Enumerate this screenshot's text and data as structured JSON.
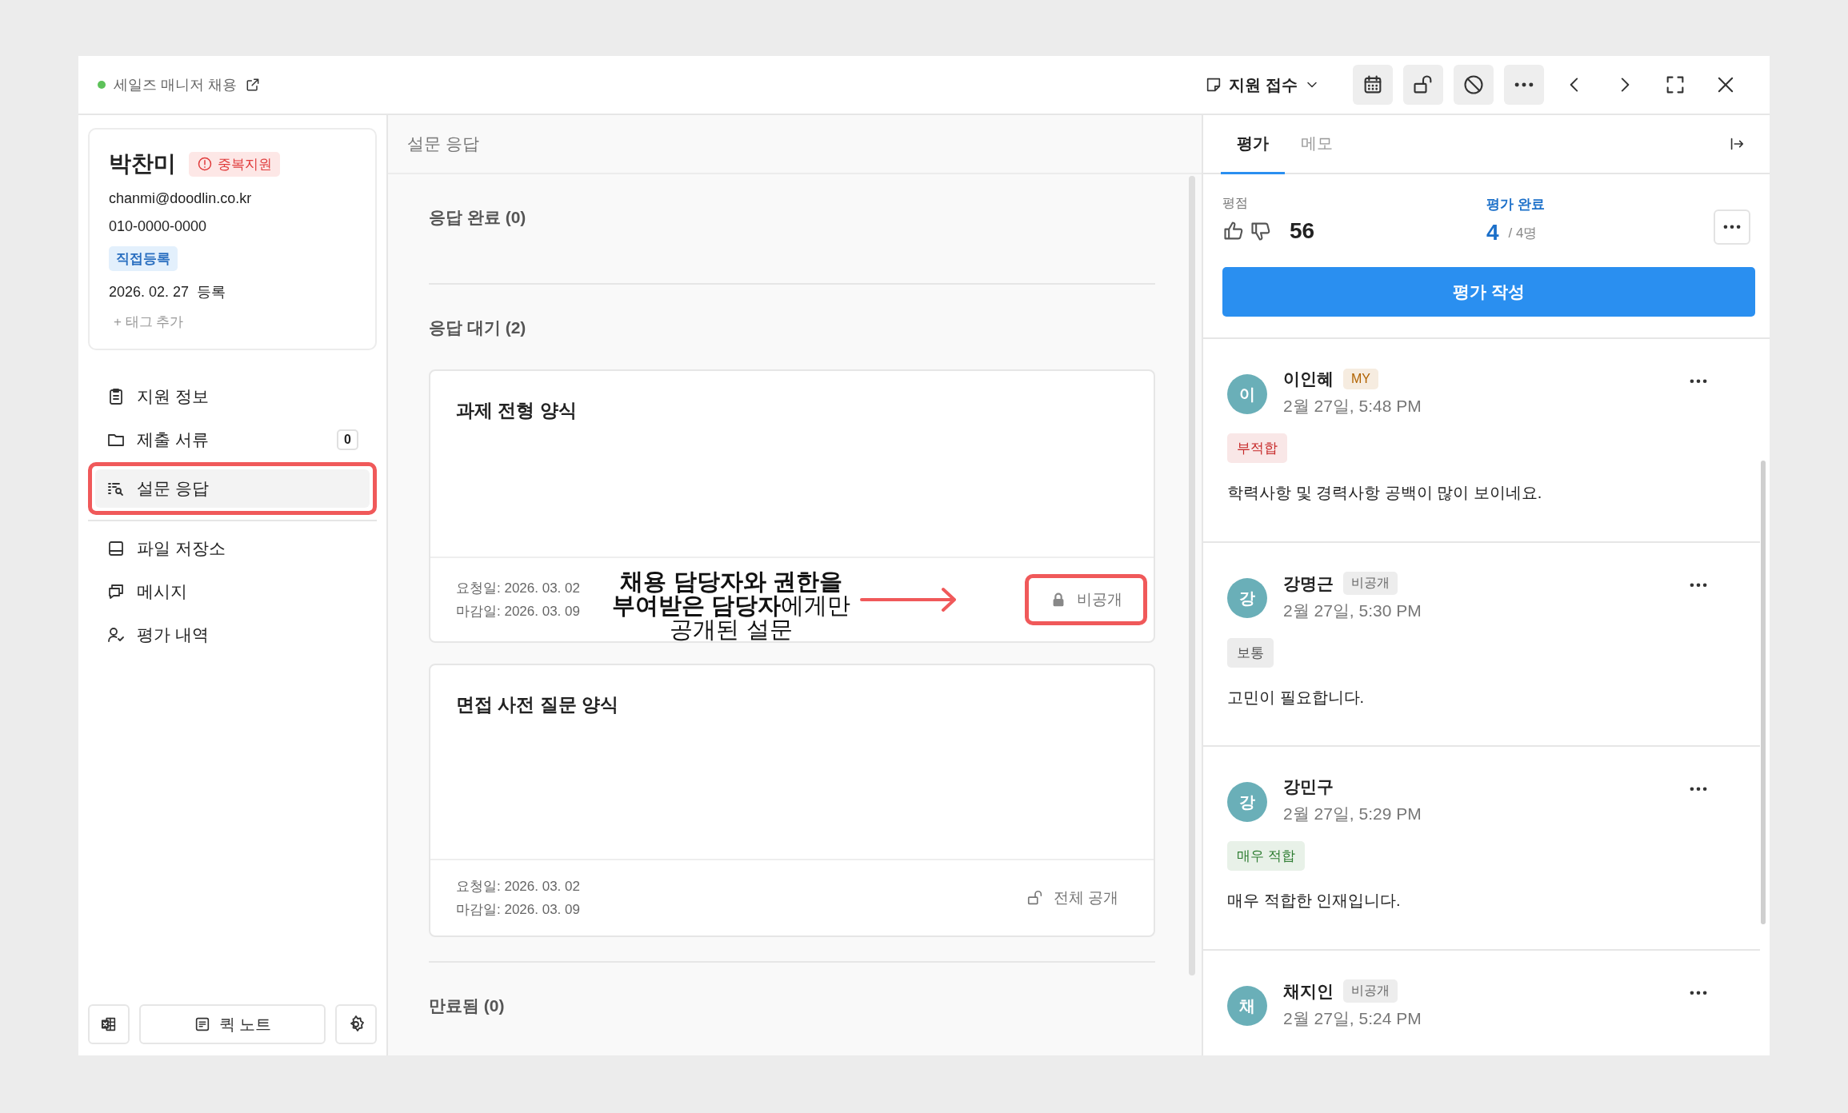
{
  "header": {
    "job_title": "세일즈 매니저 채용",
    "stage": "지원 접수"
  },
  "candidate": {
    "name": "박찬미",
    "badge": "중복지원",
    "email": "chanmi@doodlin.co.kr",
    "phone": "010-0000-0000",
    "source": "직접등록",
    "date": "2026. 02. 27  등록",
    "add_tag": "+ 태그 추가"
  },
  "nav_groups": [
    [
      {
        "label": "지원 정보",
        "selected": false,
        "highlighted": false
      },
      {
        "label": "제출 서류",
        "count": "0",
        "selected": false,
        "highlighted": false
      },
      {
        "label": "설문 응답",
        "selected": true,
        "highlighted": true
      }
    ],
    [
      {
        "label": "파일 저장소",
        "selected": false,
        "highlighted": false
      },
      {
        "label": "메시지",
        "selected": false,
        "highlighted": false
      },
      {
        "label": "평가 내역",
        "selected": false,
        "highlighted": false
      }
    ]
  ],
  "footer": {
    "quick_note": "퀵 노트"
  },
  "survey": {
    "title": "설문 응답",
    "sections": [
      {
        "heading": "응답 완료 (0)"
      },
      {
        "heading": "응답 대기 (2)",
        "cards": [
          {
            "title": "과제 전형 양식",
            "requested": "요청일: 2026. 03. 02",
            "deadline": "마감일: 2026. 03. 09",
            "visibility": "비공개",
            "kind": "private",
            "highlighted": true,
            "annotation": [
              "**채용 담당자와 권한을**",
              "**부여받은 담당자**에게만",
              "공개된 설문"
            ]
          },
          {
            "title": "면접 사전 질문 양식",
            "requested": "요청일: 2026. 03. 02",
            "deadline": "마감일: 2026. 03. 09",
            "visibility": "전체 공개",
            "kind": "public",
            "highlighted": false
          }
        ]
      },
      {
        "heading": "만료됨 (0)"
      }
    ]
  },
  "evaluation": {
    "tabs": [
      {
        "label": "평가",
        "selected": true
      },
      {
        "label": "메모",
        "selected": false
      }
    ],
    "score_label": "평점",
    "score": "56",
    "done_label": "평가 완료",
    "done_count": "4",
    "done_total": "/ 4명",
    "write_button": "평가 작성",
    "entries": [
      {
        "initial": "이",
        "name": "이인혜",
        "badge": {
          "text": "MY",
          "color": "#b06200"
        },
        "time": "2월 27일, 5:48 PM",
        "verdict": {
          "text": "부적합",
          "color": "#c62828"
        },
        "comment": "학력사항 및 경력사항 공백이 많이 보이네요."
      },
      {
        "initial": "강",
        "name": "강명근",
        "badge": {
          "text": "비공개",
          "color": "#666666"
        },
        "time": "2월 27일, 5:30 PM",
        "verdict": {
          "text": "보통",
          "color": "#555555"
        },
        "comment": "고민이 필요합니다."
      },
      {
        "initial": "강",
        "name": "강민구",
        "time": "2월 27일, 5:29 PM",
        "verdict": {
          "text": "매우 적합",
          "color": "#2e7d32"
        },
        "comment": "매우 적합한 인재입니다."
      },
      {
        "initial": "채",
        "name": "채지인",
        "badge": {
          "text": "비공개",
          "color": "#666666"
        },
        "time": "2월 27일, 5:24 PM"
      }
    ]
  }
}
